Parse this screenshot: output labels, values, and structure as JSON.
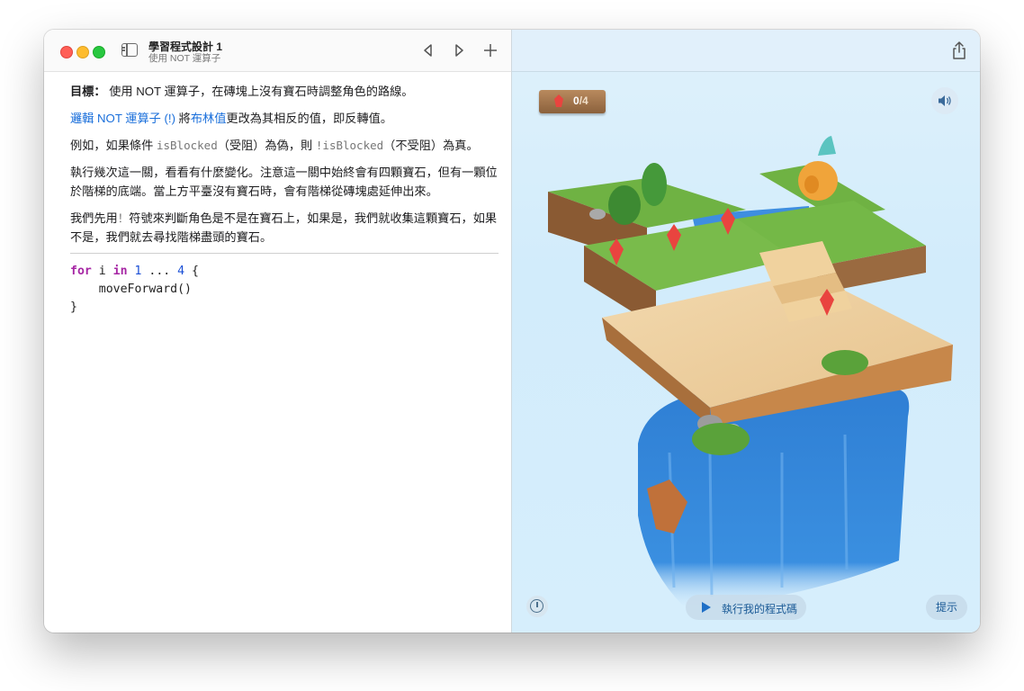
{
  "window": {
    "title": "學習程式設計 1",
    "subtitle": "使用 NOT 運算子"
  },
  "toolbar": {
    "prev_icon": "chevron-left-icon",
    "next_icon": "play-icon",
    "add_icon": "plus-icon",
    "share_icon": "share-icon"
  },
  "instructions": {
    "goal_label": "目標：",
    "goal_text": " 使用 NOT 運算子，在磚塊上沒有寶石時調整角色的路線。",
    "p2_link1": "邏輯 NOT 運算子 (!)",
    "p2_mid": " 將",
    "p2_link2": "布林值",
    "p2_end": "更改為其相反的值，即反轉值。",
    "p3_a": "例如，如果條件 ",
    "p3_code1": "isBlocked",
    "p3_b": "（受阻）為偽，則 ",
    "p3_code2": "!isBlocked",
    "p3_c": "（不受阻）為真。",
    "p4": "執行幾次這一關，看看有什麼變化。注意這一關中始終會有四顆寶石，但有一顆位於階梯的底端。當上方平臺沒有寶石時，會有階梯從磚塊處延伸出來。",
    "p5_a": "我們先用",
    "p5_code": "！",
    "p5_b": "符號來判斷角色是不是在寶石上，如果是，我們就收集這顆寶石，如果不是，我們就去尋找階梯盡頭的寶石。"
  },
  "code": {
    "kw_for": "for",
    "var_i": " i ",
    "kw_in": "in",
    "num_start": "1",
    "range_op": " ... ",
    "num_end": "4",
    "brace_open": " {",
    "body": "    moveForward()",
    "brace_close": "}"
  },
  "game": {
    "gem_count": "0",
    "gem_total": "/4",
    "sound_icon": "speaker-icon",
    "speed_icon": "speedometer-icon",
    "run_label": "執行我的程式碼",
    "hint_label": "提示"
  },
  "colors": {
    "link": "#1a6fdb",
    "keyword": "#a626a4",
    "number": "#1a4fd6",
    "gem": "#e9443f"
  }
}
